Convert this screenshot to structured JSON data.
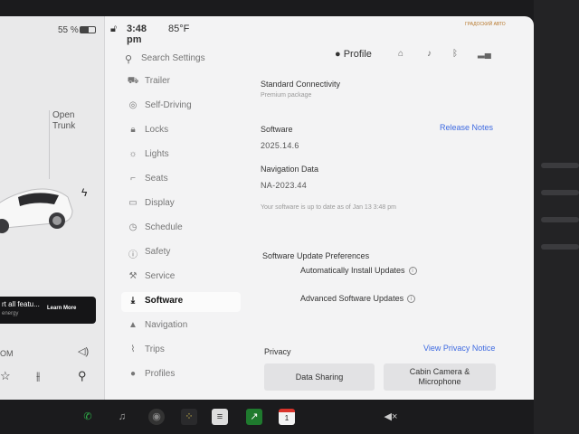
{
  "status_bar": {
    "battery_percent": "55 %",
    "battery_level": 0.55,
    "time": "3:48 pm",
    "temperature": "85°F",
    "brand_logo_text": "ГРАДОСКИЙ АВТО"
  },
  "vehicle_panel": {
    "open_trunk_line1": "Open",
    "open_trunk_line2": "Trunk",
    "promo_title": "rt all featu...",
    "promo_subtitle": "energy",
    "promo_button": "Learn More",
    "footer_label": "OM"
  },
  "top_bar": {
    "search_placeholder": "Search Settings",
    "profile_label": "Profile"
  },
  "menu": {
    "items": [
      {
        "label": "Trailer",
        "icon": "trailer-icon",
        "glyph": "⛟"
      },
      {
        "label": "Self-Driving",
        "icon": "steering-wheel-icon",
        "glyph": "◎"
      },
      {
        "label": "Locks",
        "icon": "lock-icon",
        "glyph": "🔒︎"
      },
      {
        "label": "Lights",
        "icon": "lights-icon",
        "glyph": "☼"
      },
      {
        "label": "Seats",
        "icon": "seat-icon",
        "glyph": "⌐"
      },
      {
        "label": "Display",
        "icon": "display-icon",
        "glyph": "▭"
      },
      {
        "label": "Schedule",
        "icon": "schedule-icon",
        "glyph": "◷"
      },
      {
        "label": "Safety",
        "icon": "safety-icon",
        "glyph": "ⓘ"
      },
      {
        "label": "Service",
        "icon": "wrench-icon",
        "glyph": "⚒"
      },
      {
        "label": "Software",
        "icon": "download-icon",
        "glyph": "⤓"
      },
      {
        "label": "Navigation",
        "icon": "navigation-icon",
        "glyph": "▲"
      },
      {
        "label": "Trips",
        "icon": "trips-icon",
        "glyph": "⌇"
      },
      {
        "label": "Profiles",
        "icon": "person-icon",
        "glyph": "●"
      }
    ],
    "active_index": 9
  },
  "content": {
    "connectivity_title": "Standard Connectivity",
    "connectivity_sub": "Premium package",
    "software_label": "Software",
    "software_version": "2025.14.6",
    "release_notes": "Release Notes",
    "nav_data_label": "Navigation Data",
    "nav_data_version": "NA-2023.44",
    "up_to_date": "Your software is up to date as of Jan 13 3:48 pm",
    "prefs_title": "Software Update Preferences",
    "auto_install": "Automatically Install Updates",
    "advanced_updates": "Advanced Software Updates",
    "privacy_label": "Privacy",
    "privacy_notice": "View Privacy Notice",
    "data_sharing": "Data Sharing",
    "cabin_camera_line1": "Cabin Camera &",
    "cabin_camera_line2": "Microphone"
  },
  "taskbar": {
    "calendar_day": "1",
    "colors": {
      "phone": "#2fb24a",
      "music": "#555555",
      "calendar": "#d9342b"
    }
  }
}
